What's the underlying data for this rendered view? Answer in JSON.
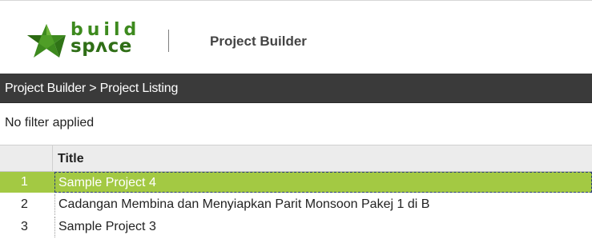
{
  "header": {
    "logo": {
      "word_top": "build",
      "word_bottom": "spʌce"
    },
    "app_title": "Project Builder"
  },
  "breadcrumb": "Project Builder > Project Listing",
  "filter": {
    "status": "No filter applied"
  },
  "grid": {
    "columns": [
      "Title"
    ],
    "rows": [
      {
        "num": "1",
        "title": "Sample Project 4",
        "selected": true
      },
      {
        "num": "2",
        "title": "Cadangan Membina dan Menyiapkan Parit Monsoon Pakej 1 di B",
        "selected": false
      },
      {
        "num": "3",
        "title": "Sample Project 3",
        "selected": false
      }
    ]
  },
  "colors": {
    "brand_green": "#3d8a1e",
    "breadcrumb_bg": "#3a3a3a",
    "selected_row": "#a3c943"
  }
}
